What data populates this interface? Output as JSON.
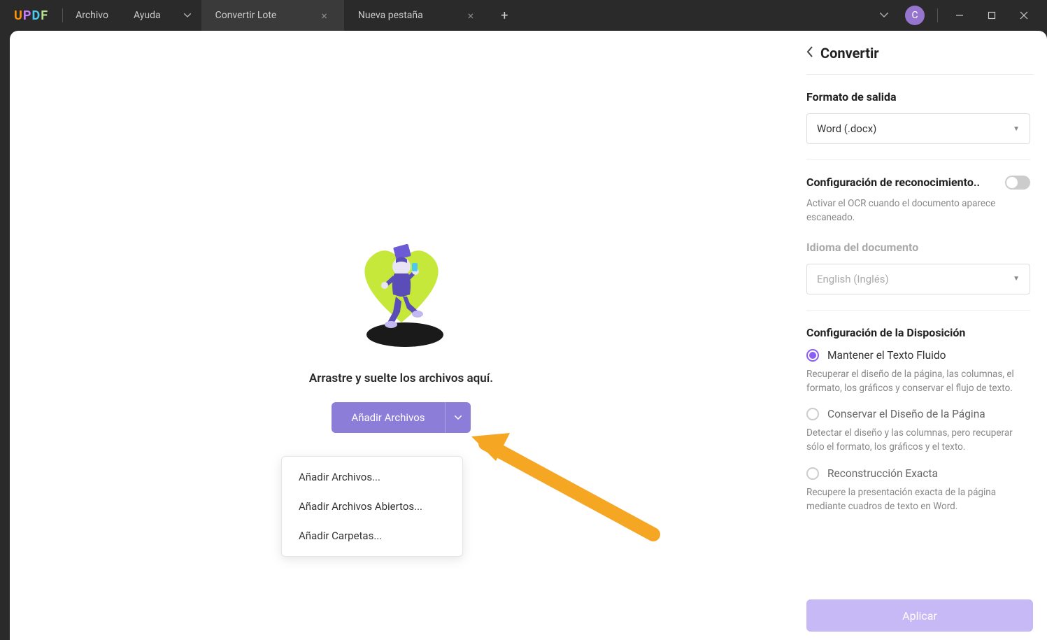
{
  "logo": {
    "u": "U",
    "p": "P",
    "d": "D",
    "f": "F"
  },
  "menu": {
    "file": "Archivo",
    "help": "Ayuda"
  },
  "tabs": [
    {
      "label": "Convertir Lote",
      "active": true
    },
    {
      "label": "Nueva pestaña",
      "active": false
    }
  ],
  "avatar_initial": "C",
  "main": {
    "drop_text": "Arrastre y suelte los archivos aquí.",
    "add_button": "Añadir Archivos",
    "dropdown": [
      "Añadir Archivos...",
      "Añadir Archivos Abiertos...",
      "Añadir Carpetas..."
    ]
  },
  "sidebar": {
    "title": "Convertir",
    "output_format_label": "Formato de salida",
    "output_format_value": "Word (.docx)",
    "ocr_label": "Configuración de reconocimiento..",
    "ocr_help": "Activar el OCR cuando el documento aparece escaneado.",
    "doc_lang_label": "Idioma del documento",
    "doc_lang_value": "English (Inglés)",
    "layout_label": "Configuración de la Disposición",
    "radios": [
      {
        "label": "Mantener el Texto Fluido",
        "help": "Recuperar el diseño de la página, las columnas, el formato, los gráficos y conservar el flujo de texto.",
        "checked": true
      },
      {
        "label": "Conservar el Diseño de la Página",
        "help": "Detectar el diseño y las columnas, pero recuperar sólo el formato, los gráficos y el texto.",
        "checked": false
      },
      {
        "label": "Reconstrucción Exacta",
        "help": "Recupere la presentación exacta de la página mediante cuadros de texto en Word.",
        "checked": false
      }
    ],
    "apply": "Aplicar"
  }
}
